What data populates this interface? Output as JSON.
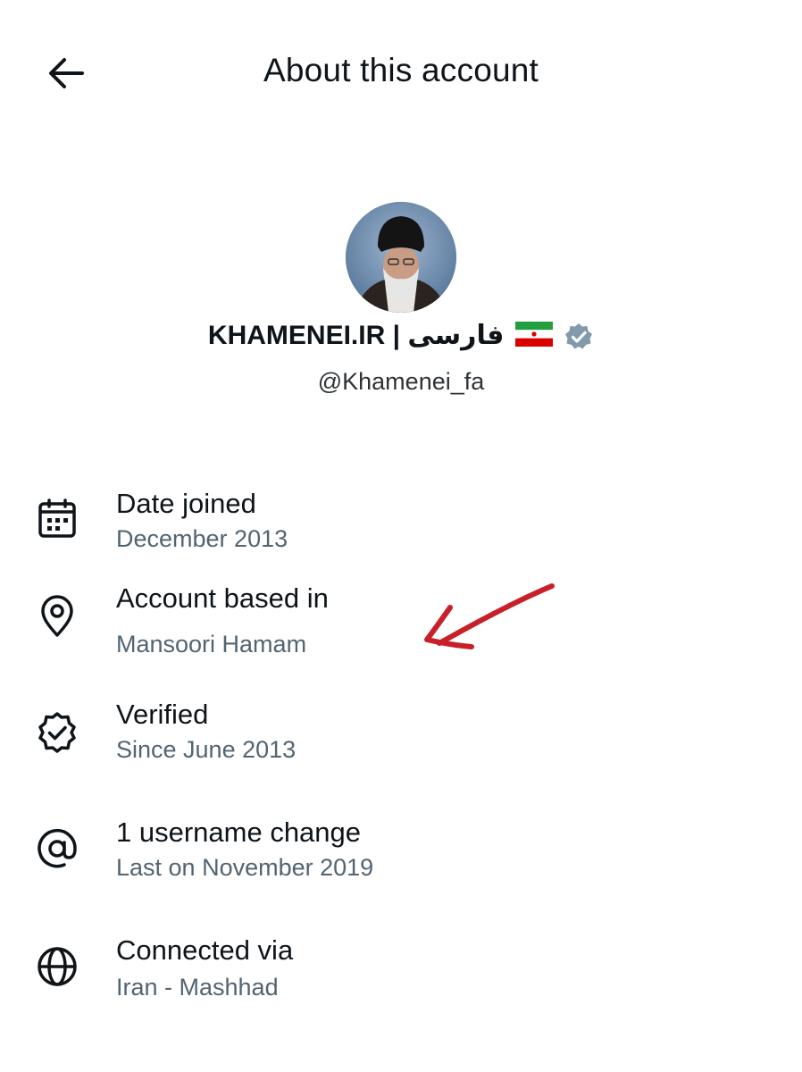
{
  "header": {
    "title": "About this account",
    "back_icon": "arrow-left-icon"
  },
  "profile": {
    "display_name": "KHAMENEI.IR | فارسی",
    "flag_icon": "iran-flag-icon",
    "verified_icon": "verified-badge-icon",
    "handle": "@Khamenei_fa"
  },
  "details": [
    {
      "icon": "calendar-icon",
      "label": "Date joined",
      "value": "December 2013"
    },
    {
      "icon": "location-pin-icon",
      "label": "Account based in",
      "value": "Mansoori Hamam"
    },
    {
      "icon": "verified-seal-icon",
      "label": "Verified",
      "value": "Since June 2013"
    },
    {
      "icon": "at-sign-icon",
      "label": "1 username change",
      "value": "Last on November 2019"
    },
    {
      "icon": "globe-icon",
      "label": "Connected via",
      "value": "Iran - Mashhad"
    }
  ],
  "colors": {
    "text": "#0f1419",
    "secondary": "#536471",
    "badge": "#829aab",
    "annotation": "#c8202a"
  }
}
